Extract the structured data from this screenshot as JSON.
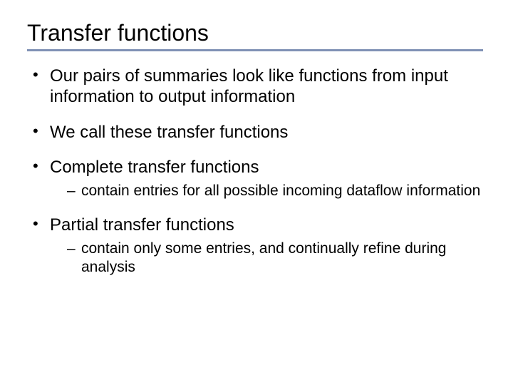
{
  "title": "Transfer functions",
  "bullets": [
    {
      "text": "Our pairs of summaries look like functions from input information to output information",
      "sub": []
    },
    {
      "text": "We call these transfer functions",
      "sub": []
    },
    {
      "text": "Complete transfer functions",
      "sub": [
        "contain entries for all possible incoming dataflow information"
      ]
    },
    {
      "text": "Partial transfer functions",
      "sub": [
        "contain only some entries, and continually refine during analysis"
      ]
    }
  ]
}
